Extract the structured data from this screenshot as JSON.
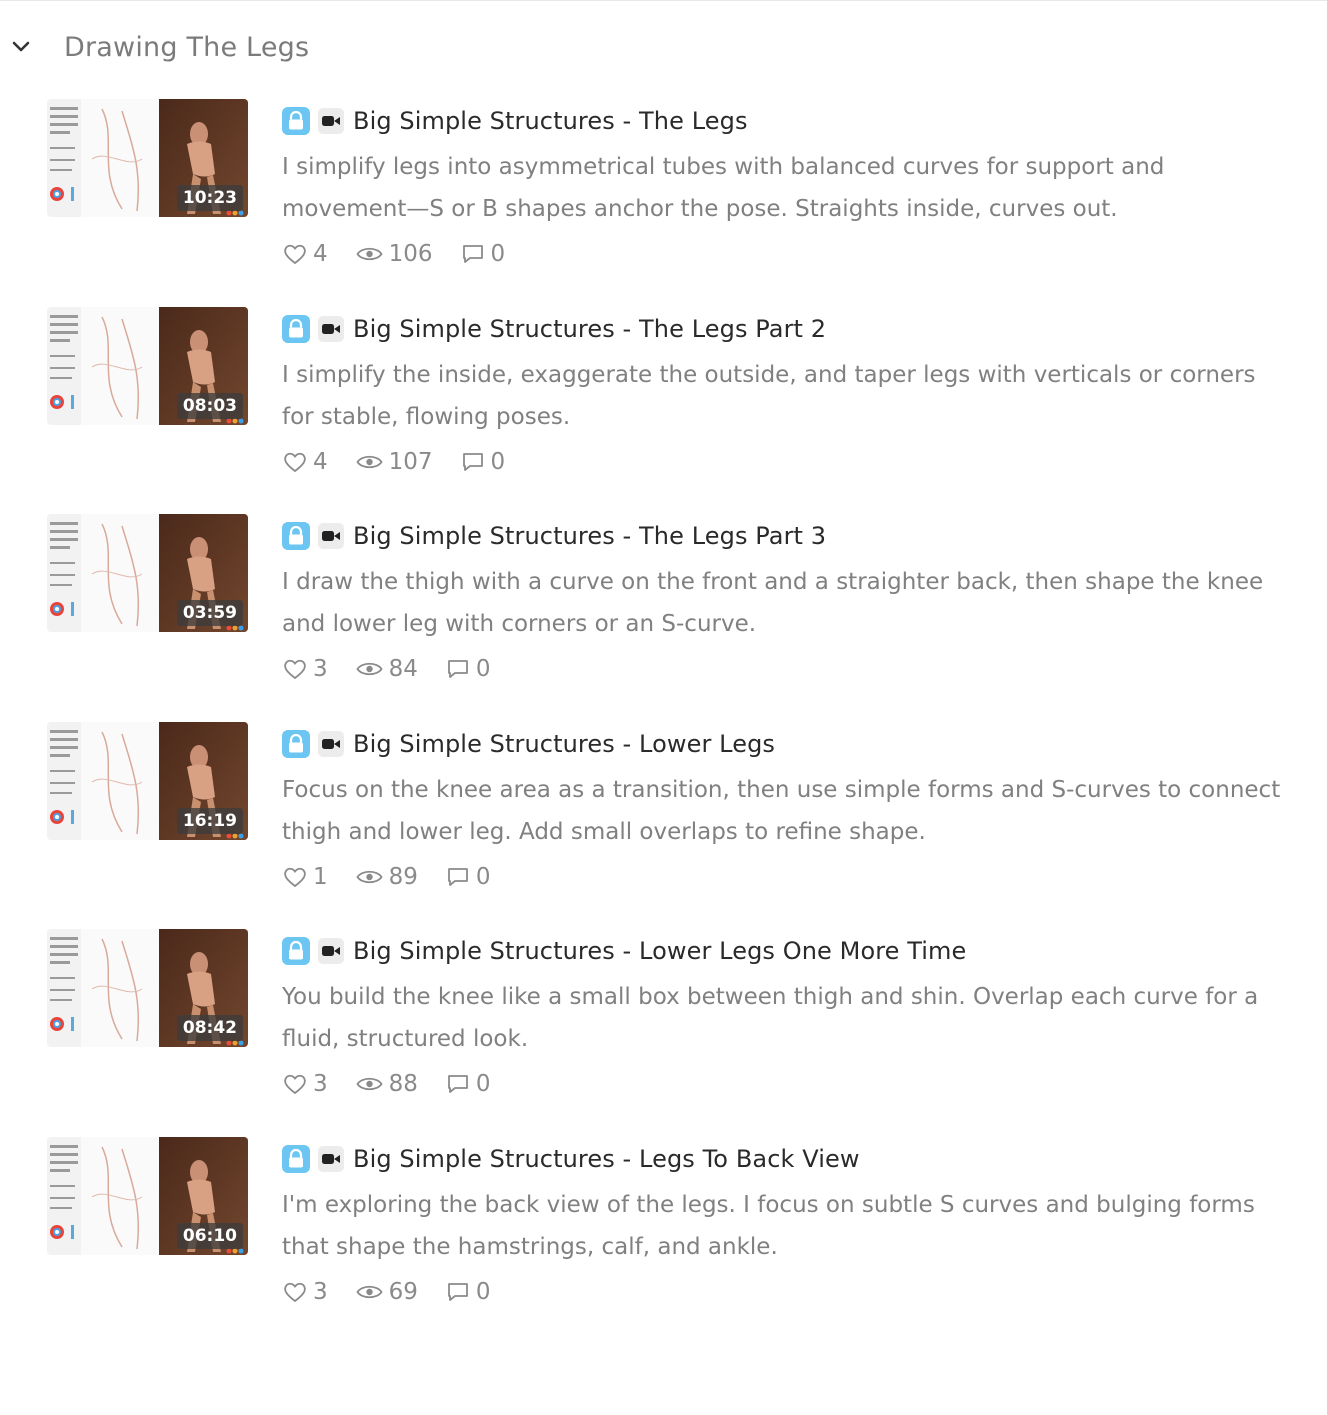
{
  "section": {
    "title": "Drawing The Legs",
    "chevron_icon": "chevron-down-icon"
  },
  "colors": {
    "lock_badge": "#6cc6f2",
    "title_text": "#2a2a2a",
    "description_text": "#808080",
    "stat_text": "#8a8a8a"
  },
  "lessons": [
    {
      "title": "Big Simple Structures - The Legs",
      "description": "I simplify legs into asymmetrical tubes with balanced curves for support and movement—S or B shapes anchor the pose. Straights inside, curves out.",
      "duration": "10:23",
      "likes": "4",
      "views": "106",
      "comments": "0"
    },
    {
      "title": "Big Simple Structures - The Legs Part 2",
      "description": "I simplify the inside, exaggerate the outside, and taper legs with verticals or corners for stable, flowing poses.",
      "duration": "08:03",
      "likes": "4",
      "views": "107",
      "comments": "0"
    },
    {
      "title": "Big Simple Structures - The Legs Part 3",
      "description": "I draw the thigh with a curve on the front and a straighter back, then shape the knee and lower leg with corners or an S-curve.",
      "duration": "03:59",
      "likes": "3",
      "views": "84",
      "comments": "0"
    },
    {
      "title": "Big Simple Structures - Lower Legs",
      "description": "Focus on the knee area as a transition, then use simple forms and S-curves to connect thigh and lower leg. Add small overlaps to refine shape.",
      "duration": "16:19",
      "likes": "1",
      "views": "89",
      "comments": "0"
    },
    {
      "title": "Big Simple Structures - Lower Legs One More Time",
      "description": "You build the knee like a small box between thigh and shin. Overlap each curve for a fluid, structured look.",
      "duration": "08:42",
      "likes": "3",
      "views": "88",
      "comments": "0"
    },
    {
      "title": "Big Simple Structures - Legs To Back View",
      "description": "I'm exploring the back view of the legs. I focus on subtle S curves and bulging forms that shape the hamstrings, calf, and ankle.",
      "duration": "06:10",
      "likes": "3",
      "views": "69",
      "comments": "0"
    }
  ]
}
